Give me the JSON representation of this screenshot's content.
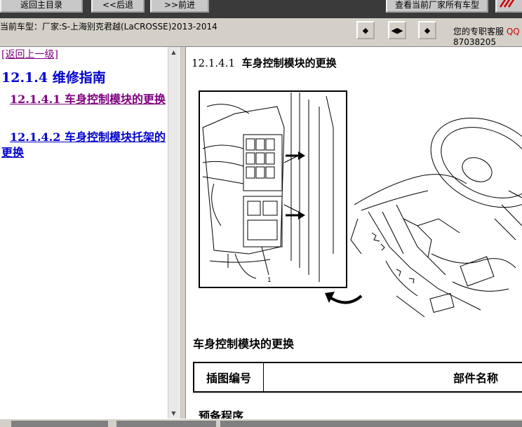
{
  "toolbar": {
    "home_label": "返回主目录",
    "back_label": "<<后退",
    "forward_label": ">>前进",
    "all_models_label": "查看当前厂家所有车型"
  },
  "infobar": {
    "vehicle": "当前车型：厂家:S-上海别克君越(LaCROSSE)2013-2014",
    "customer_service_label": "您的专职客服",
    "qq_label": "QQ",
    "customer_service_number": "87038205"
  },
  "left_nav": {
    "back_link": "[返回上一级]",
    "section_title": "12.1.4  维修指南",
    "items": [
      {
        "number": "12.1.4.1",
        "label": "车身控制模块的更换"
      },
      {
        "number": "12.1.4.2",
        "label": "车身控制模块托架的更换"
      }
    ]
  },
  "content": {
    "heading_number": "12.1.4.1",
    "heading_text": "车身控制模块的更换",
    "figure_callout": "1",
    "sub_heading": "车身控制模块的更换",
    "table_headers": [
      "插图编号",
      "部件名称"
    ],
    "preparation_label": "预备程序"
  }
}
